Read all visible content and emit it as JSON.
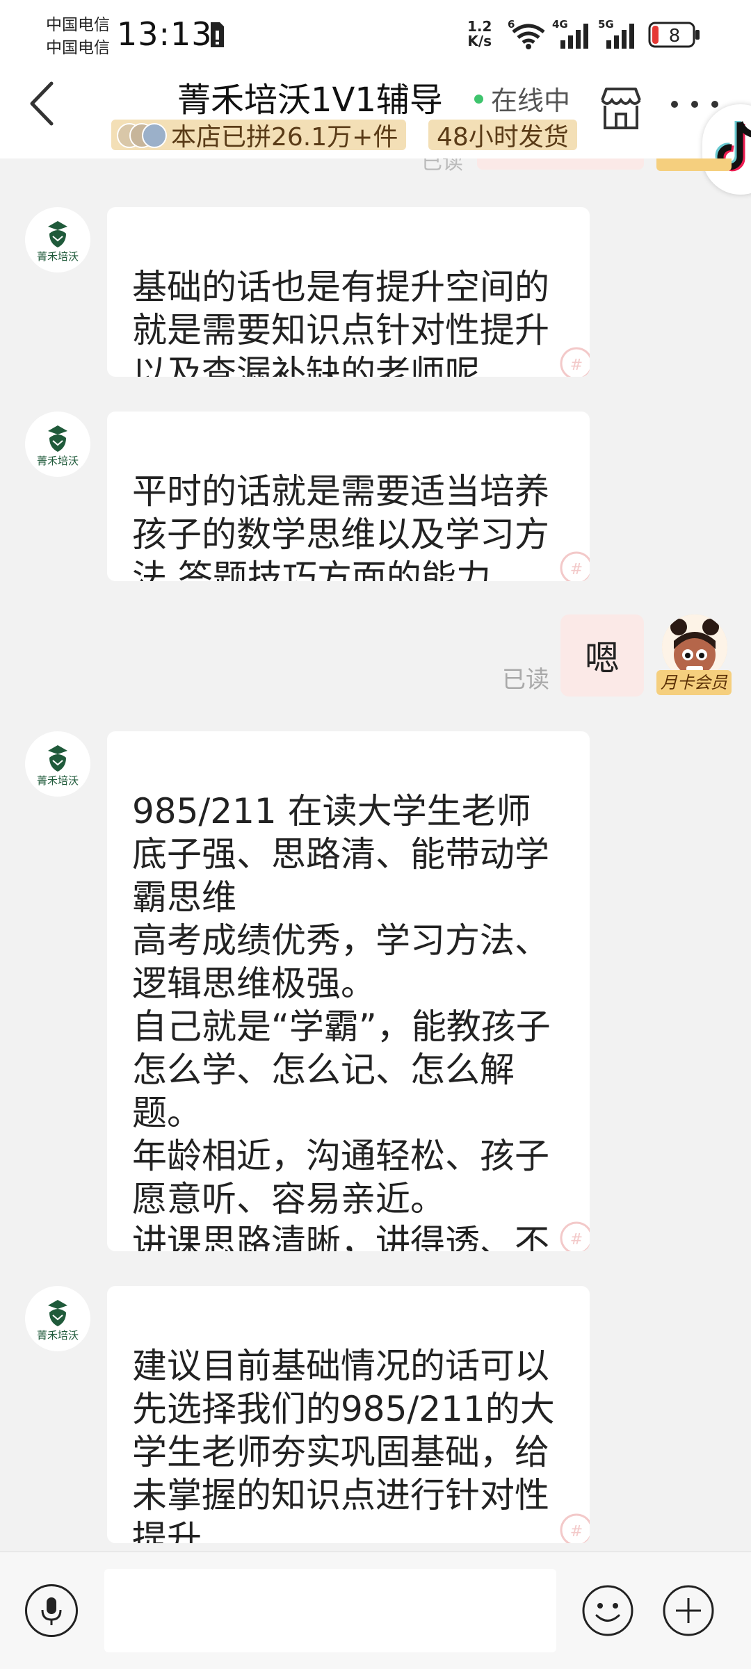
{
  "status_bar": {
    "carrier_1": "中国电信",
    "carrier_2": "中国电信",
    "time": "13:13",
    "net_speed_value": "1.2",
    "net_speed_unit": "K/s",
    "signal_1_label": "4G",
    "signal_2_label": "5G",
    "wifi_label": "6",
    "battery_level": "8",
    "icons": [
      "sim-card-icon",
      "wifi-icon",
      "signal-icon",
      "battery-icon"
    ]
  },
  "header": {
    "title": "菁禾培沃1V1辅导",
    "online_status": "在线中",
    "sales_tag": "本店已拼26.1万+件",
    "shipping_tag": "48小时发货",
    "icons": [
      "back-icon",
      "store-icon",
      "more-icon"
    ]
  },
  "chat": {
    "shop_avatar_label": "菁禾培沃",
    "messages": [
      {
        "side": "left",
        "text": "基础的话也是有提升空间的\n就是需要知识点针对性提升\n以及查漏补缺的老师呢"
      },
      {
        "side": "left",
        "text": "平时的话就是需要适当培养\n孩子的数学思维以及学习方\n法 答题技巧方面的能力"
      },
      {
        "side": "right",
        "text": "嗯",
        "status": "已读"
      },
      {
        "side": "left",
        "text": "985/211 在读大学生老师\n底子强、思路清、能带动学\n霸思维\n高考成绩优秀，学习方法、\n逻辑思维极强。\n自己就是“学霸”，能教孩子\n怎么学、怎么记、怎么解题。\n年龄相近，沟通轻松、孩子\n愿意听、容易亲近。\n讲课思路清晰，讲得透、不\n绕弯"
      },
      {
        "side": "left",
        "text": "建议目前基础情况的话可以\n先选择我们的985/211的大\n学生老师夯实巩固基础，给\n未掌握的知识点进行针对性\n提升"
      }
    ],
    "user_badge": "月卡会员",
    "partial_read_label": "已读"
  },
  "input_bar": {
    "placeholder": "",
    "icons": [
      "microphone-icon",
      "emoji-icon",
      "plus-icon"
    ]
  }
}
